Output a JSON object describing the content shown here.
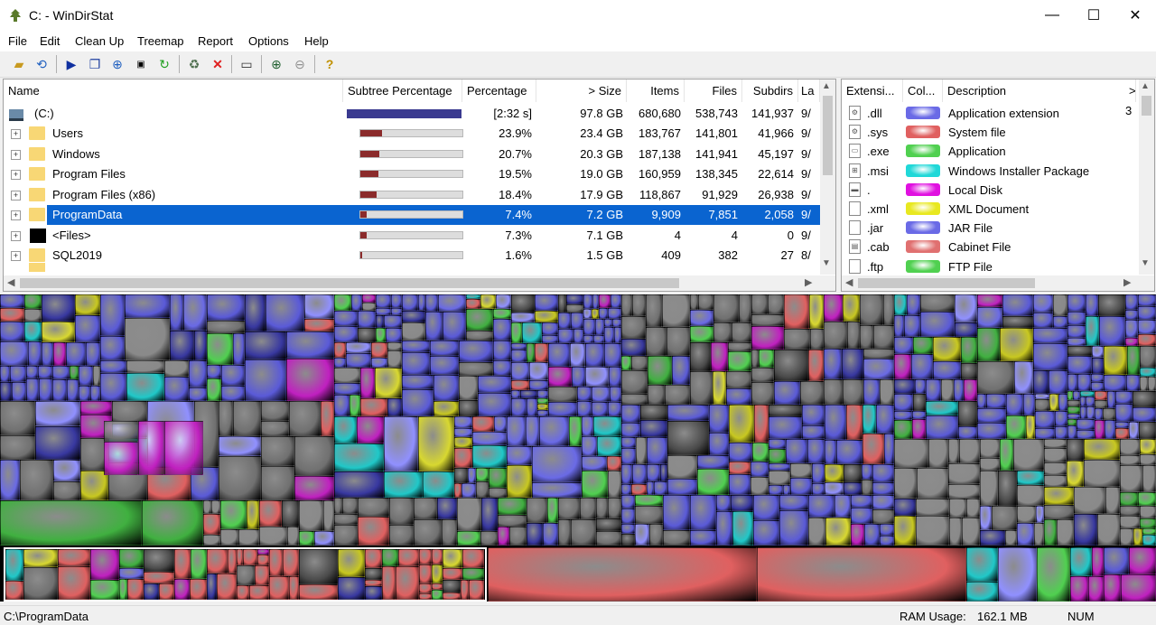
{
  "window": {
    "title": "C: - WinDirStat",
    "minimize_glyph": "—",
    "maximize_glyph": "☐",
    "close_glyph": "✕"
  },
  "menu": [
    "File",
    "Edit",
    "Clean Up",
    "Treemap",
    "Report",
    "Options",
    "Help"
  ],
  "toolbar": {
    "icons": [
      "open-icon",
      "refresh-icon",
      "play-icon",
      "copy-icon",
      "explorer-icon",
      "command-prompt-icon",
      "refresh-selected-icon",
      "recycle-icon",
      "delete-icon",
      "properties-icon",
      "zoom-in-icon",
      "zoom-out-icon",
      "help-icon"
    ]
  },
  "directory_list": {
    "columns": [
      "Name",
      "Subtree Percentage",
      "Percentage",
      "> Size",
      "Items",
      "Files",
      "Subdirs",
      "La"
    ],
    "root": {
      "name": "(C:)",
      "percentage": "[2:32 s]",
      "size": "97.8 GB",
      "items": "680,680",
      "files": "538,743",
      "subdirs": "141,937",
      "last": "9/"
    },
    "rows": [
      {
        "name": "Users",
        "subtree": 0.239,
        "percentage": "23.9%",
        "size": "23.4 GB",
        "items": "183,767",
        "files": "141,801",
        "subdirs": "41,966",
        "last": "9/"
      },
      {
        "name": "Windows",
        "subtree": 0.207,
        "percentage": "20.7%",
        "size": "20.3 GB",
        "items": "187,138",
        "files": "141,941",
        "subdirs": "45,197",
        "last": "9/"
      },
      {
        "name": "Program Files",
        "subtree": 0.195,
        "percentage": "19.5%",
        "size": "19.0 GB",
        "items": "160,959",
        "files": "138,345",
        "subdirs": "22,614",
        "last": "9/"
      },
      {
        "name": "Program Files (x86)",
        "subtree": 0.184,
        "percentage": "18.4%",
        "size": "17.9 GB",
        "items": "118,867",
        "files": "91,929",
        "subdirs": "26,938",
        "last": "9/"
      },
      {
        "name": "ProgramData",
        "subtree": 0.074,
        "percentage": "7.4%",
        "size": "7.2 GB",
        "items": "9,909",
        "files": "7,851",
        "subdirs": "2,058",
        "last": "9/",
        "selected": true
      },
      {
        "name": "<Files>",
        "subtree": 0.073,
        "percentage": "7.3%",
        "size": "7.1 GB",
        "items": "4",
        "files": "4",
        "subdirs": "0",
        "last": "9/"
      },
      {
        "name": "SQL2019",
        "subtree": 0.016,
        "percentage": "1.6%",
        "size": "1.5 GB",
        "items": "409",
        "files": "382",
        "subdirs": "27",
        "last": "8/"
      }
    ]
  },
  "extension_list": {
    "columns": [
      "Extensi...",
      "Col...",
      "Description"
    ],
    "rows": [
      {
        "ext": ".dll",
        "color": "#6a6ae6",
        "description": "Application extension"
      },
      {
        "ext": ".sys",
        "color": "#e06060",
        "description": "System file"
      },
      {
        "ext": ".exe",
        "color": "#50d050",
        "description": "Application"
      },
      {
        "ext": ".msi",
        "color": "#20d8d8",
        "description": "Windows Installer Package"
      },
      {
        "ext": ".",
        "color": "#e010e0",
        "description": "Local Disk"
      },
      {
        "ext": ".xml",
        "color": "#e8e820",
        "description": "XML Document"
      },
      {
        "ext": ".jar",
        "color": "#6a6ae6",
        "description": "JAR File"
      },
      {
        "ext": ".cab",
        "color": "#e07070",
        "description": "Cabinet File"
      },
      {
        "ext": ".ftp",
        "color": "#50d050",
        "description": "FTP File"
      }
    ],
    "first_row_trailing": "3"
  },
  "status": {
    "path": "C:\\ProgramData",
    "ram_label": "RAM Usage:",
    "ram_value": "162.1 MB",
    "num": "NUM"
  }
}
